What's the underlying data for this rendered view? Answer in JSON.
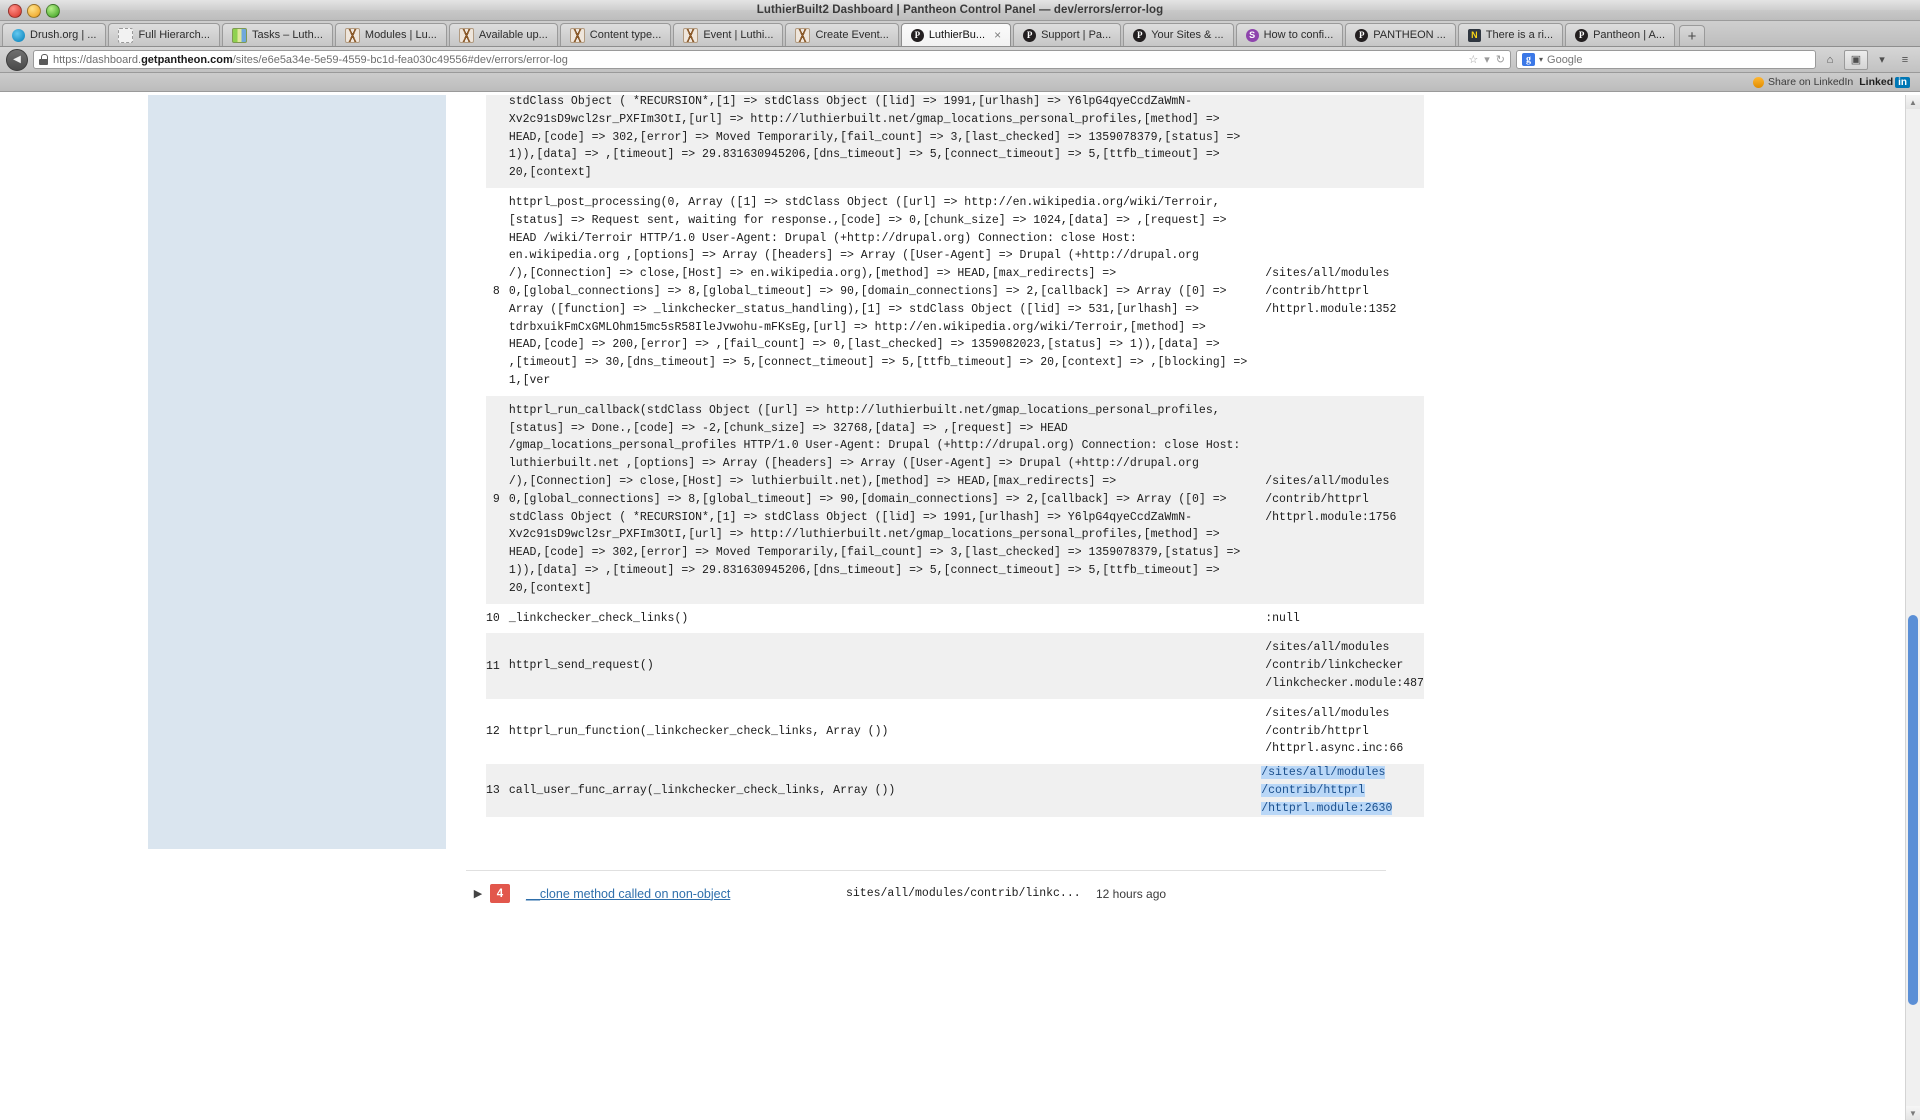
{
  "window": {
    "title": "LuthierBuilt2 Dashboard | Pantheon Control Panel — dev/errors/error-log",
    "controls": {
      "close": "close",
      "minimize": "minimize",
      "zoom": "zoom"
    }
  },
  "tabs": [
    {
      "label": "Drush.org | ...",
      "icon": "drush-icon",
      "active": false
    },
    {
      "label": "Full Hierarch...",
      "icon": "placeholder-icon",
      "active": false
    },
    {
      "label": "Tasks – Luth...",
      "icon": "books-icon",
      "active": false
    },
    {
      "label": "Modules | Lu...",
      "icon": "drupal-icon",
      "active": false
    },
    {
      "label": "Available up...",
      "icon": "drupal-icon",
      "active": false
    },
    {
      "label": "Content type...",
      "icon": "drupal-icon",
      "active": false
    },
    {
      "label": "Event | Luthi...",
      "icon": "drupal-icon",
      "active": false
    },
    {
      "label": "Create Event...",
      "icon": "drupal-icon",
      "active": false
    },
    {
      "label": "LuthierBu...",
      "icon": "pantheon-icon",
      "active": true,
      "close": "×"
    },
    {
      "label": "Support | Pa...",
      "icon": "pantheon-icon",
      "active": false
    },
    {
      "label": "Your Sites & ...",
      "icon": "pantheon-icon",
      "active": false
    },
    {
      "label": "How to confi...",
      "icon": "purple-s-icon",
      "active": false
    },
    {
      "label": "PANTHEON ...",
      "icon": "pantheon-icon",
      "active": false
    },
    {
      "label": "There is a ri...",
      "icon": "yellow-icon",
      "active": false
    },
    {
      "label": "Pantheon | A...",
      "icon": "pantheon-icon",
      "active": false
    }
  ],
  "new_tab_label": "+",
  "toolbar": {
    "back_label": "◀",
    "url_prefix": "https://dashboard.",
    "url_domain": "getpantheon.com",
    "url_path": "/sites/e6e5a34e-5e59-4559-bc1d-fea030c49556#dev/errors/error-log",
    "url_full": "https://dashboard.getpantheon.com/sites/e6e5a34e-5e59-4559-bc1d-fea030c49556#dev/errors/error-log",
    "bookmark_icon": "☆",
    "bookmark_dropdown_icon": "▾",
    "reload_icon": "↻",
    "search_engine": "Google",
    "search_placeholder": "Google",
    "search_dropdown_icon": "▾",
    "home_icon": "⌂",
    "reader_icon": "▣",
    "reader_dropdown_icon": "▾",
    "menu_icon": "≡"
  },
  "addon_bar": {
    "share_label": "Share on LinkedIn",
    "brand_label": "Linked",
    "brand_suffix": "in"
  },
  "stack_trace": {
    "accent_selection": "#b9d7f7",
    "rows": [
      {
        "num": "",
        "fn": "stdClass Object ( *RECURSION*,[1] => stdClass Object ([lid] => 1991,[urlhash] => Y6lpG4qyeCcdZaWmN-\nXv2c91sD9wcl2sr_PXFIm3OtI,[url] => http://luthierbuilt.net/gmap_locations_personal_profiles,[method] =>\nHEAD,[code] => 302,[error] => Moved Temporarily,[fail_count] => 3,[last_checked] => 1359078379,[status] =>\n1)),[data] => ,[timeout] => 29.831630945206,[dns_timeout] => 5,[connect_timeout] => 5,[ttfb_timeout] =>\n20,[context]",
        "file": "",
        "alt": true
      },
      {
        "num": "8",
        "fn": "httprl_post_processing(0, Array ([1] => stdClass Object ([url] => http://en.wikipedia.org/wiki/Terroir,\n[status] => Request sent, waiting for response.,[code] => 0,[chunk_size] => 1024,[data] => ,[request] =>\nHEAD /wiki/Terroir HTTP/1.0 User-Agent: Drupal (+http://drupal.org) Connection: close Host:\nen.wikipedia.org ,[options] => Array ([headers] => Array ([User-Agent] => Drupal (+http://drupal.org\n/),[Connection] => close,[Host] => en.wikipedia.org),[method] => HEAD,[max_redirects] =>\n0,[global_connections] => 8,[global_timeout] => 90,[domain_connections] => 2,[callback] => Array ([0] =>\nArray ([function] => _linkchecker_status_handling),[1] => stdClass Object ([lid] => 531,[urlhash] =>\ntdrbxuikFmCxGMLOhm15mc5sR58IleJvwohu-mFKsEg,[url] => http://en.wikipedia.org/wiki/Terroir,[method] =>\nHEAD,[code] => 200,[error] => ,[fail_count] => 0,[last_checked] => 1359082023,[status] => 1)),[data] =>\n,[timeout] => 30,[dns_timeout] => 5,[connect_timeout] => 5,[ttfb_timeout] => 20,[context] => ,[blocking] =>\n1,[ver",
        "file": "/sites/all/modules\n/contrib/httprl\n/httprl.module:1352",
        "alt": false
      },
      {
        "num": "9",
        "fn": "httprl_run_callback(stdClass Object ([url] => http://luthierbuilt.net/gmap_locations_personal_profiles,\n[status] => Done.,[code] => -2,[chunk_size] => 32768,[data] => ,[request] => HEAD\n/gmap_locations_personal_profiles HTTP/1.0 User-Agent: Drupal (+http://drupal.org) Connection: close Host:\nluthierbuilt.net ,[options] => Array ([headers] => Array ([User-Agent] => Drupal (+http://drupal.org\n/),[Connection] => close,[Host] => luthierbuilt.net),[method] => HEAD,[max_redirects] =>\n0,[global_connections] => 8,[global_timeout] => 90,[domain_connections] => 2,[callback] => Array ([0] =>\nstdClass Object ( *RECURSION*,[1] => stdClass Object ([lid] => 1991,[urlhash] => Y6lpG4qyeCcdZaWmN-\nXv2c91sD9wcl2sr_PXFIm3OtI,[url] => http://luthierbuilt.net/gmap_locations_personal_profiles,[method] =>\nHEAD,[code] => 302,[error] => Moved Temporarily,[fail_count] => 3,[last_checked] => 1359078379,[status] =>\n1)),[data] => ,[timeout] => 29.831630945206,[dns_timeout] => 5,[connect_timeout] => 5,[ttfb_timeout] =>\n20,[context]",
        "file": "/sites/all/modules\n/contrib/httprl\n/httprl.module:1756",
        "alt": true
      },
      {
        "num": "10",
        "fn": "_linkchecker_check_links()",
        "file": ":null",
        "alt": false
      },
      {
        "num": "11",
        "fn": "httprl_send_request()",
        "file": "/sites/all/modules\n/contrib/linkchecker\n/linkchecker.module:487",
        "alt": true
      },
      {
        "num": "12",
        "fn": "httprl_run_function(_linkchecker_check_links, Array ())",
        "file": "/sites/all/modules\n/contrib/httprl\n/httprl.async.inc:66",
        "alt": false
      },
      {
        "num": "13",
        "fn": "call_user_func_array(_linkchecker_check_links, Array ())",
        "file": "/sites/all/modules\n/contrib/httprl\n/httprl.module:2630",
        "file_highlighted": true,
        "alt": true
      }
    ]
  },
  "error_entry": {
    "toggle_icon": "▶",
    "count": "4",
    "title": "__clone method called on non-object",
    "path": "sites/all/modules/contrib/linkc...",
    "time": "12 hours ago"
  },
  "scrollbar": {
    "up_arrow": "▲",
    "down_arrow": "▼"
  }
}
